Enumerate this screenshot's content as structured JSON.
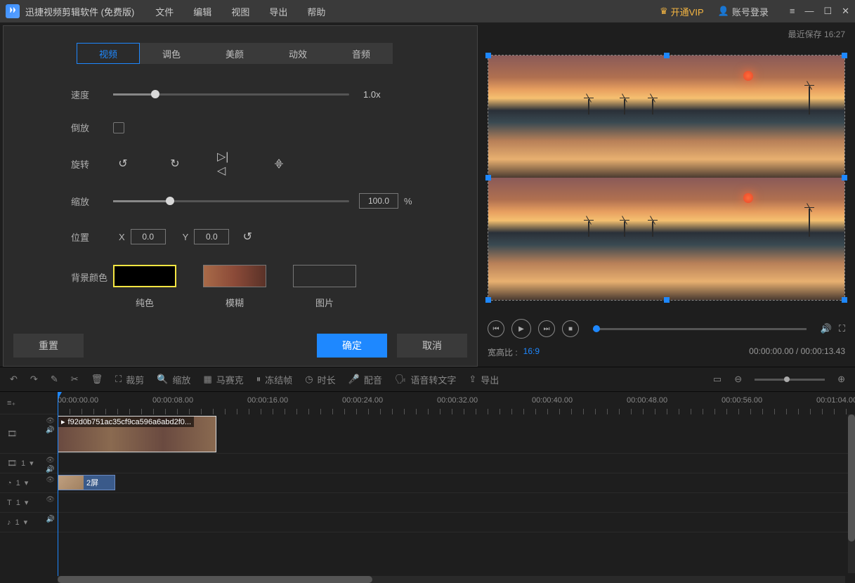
{
  "titlebar": {
    "app_name": "迅捷视频剪辑软件 (免费版)",
    "menu": [
      "文件",
      "编辑",
      "视图",
      "导出",
      "帮助"
    ],
    "vip": "开通VIP",
    "login": "账号登录"
  },
  "panel": {
    "tabs": [
      "视频",
      "调色",
      "美颜",
      "动效",
      "音频"
    ],
    "active_tab": 0,
    "speed_label": "速度",
    "speed_value": "1.0x",
    "reverse_label": "倒放",
    "rotate_label": "旋转",
    "scale_label": "缩放",
    "scale_value": "100.0",
    "scale_unit": "%",
    "position_label": "位置",
    "pos_x_label": "X",
    "pos_x_value": "0.0",
    "pos_y_label": "Y",
    "pos_y_value": "0.0",
    "bg_label": "背景颜色",
    "bg_opts": [
      "纯色",
      "模糊",
      "图片"
    ],
    "reset_btn": "重置",
    "ok_btn": "确定",
    "cancel_btn": "取消"
  },
  "preview": {
    "last_save": "最近保存 16:27",
    "ratio_label": "宽高比 :",
    "ratio_value": "16:9",
    "time_current": "00:00:00.00",
    "time_total": "00:00:13.43"
  },
  "toolbar": {
    "items": [
      "裁剪",
      "缩放",
      "马赛克",
      "冻结帧",
      "时长",
      "配音",
      "语音转文字",
      "导出"
    ]
  },
  "timeline": {
    "labels": [
      "00:00:00.00",
      "00:00:08.00",
      "00:00:16.00",
      "00:00:24.00",
      "00:00:32.00",
      "00:00:40.00",
      "00:00:48.00",
      "00:00:56.00",
      "00:01:04.00"
    ],
    "clip1_name": "f92d0b751ac35cf9ca596a6abd2f0...",
    "clip2_name": "2屏",
    "track_counts": [
      "1",
      "1",
      "1",
      "1"
    ]
  }
}
